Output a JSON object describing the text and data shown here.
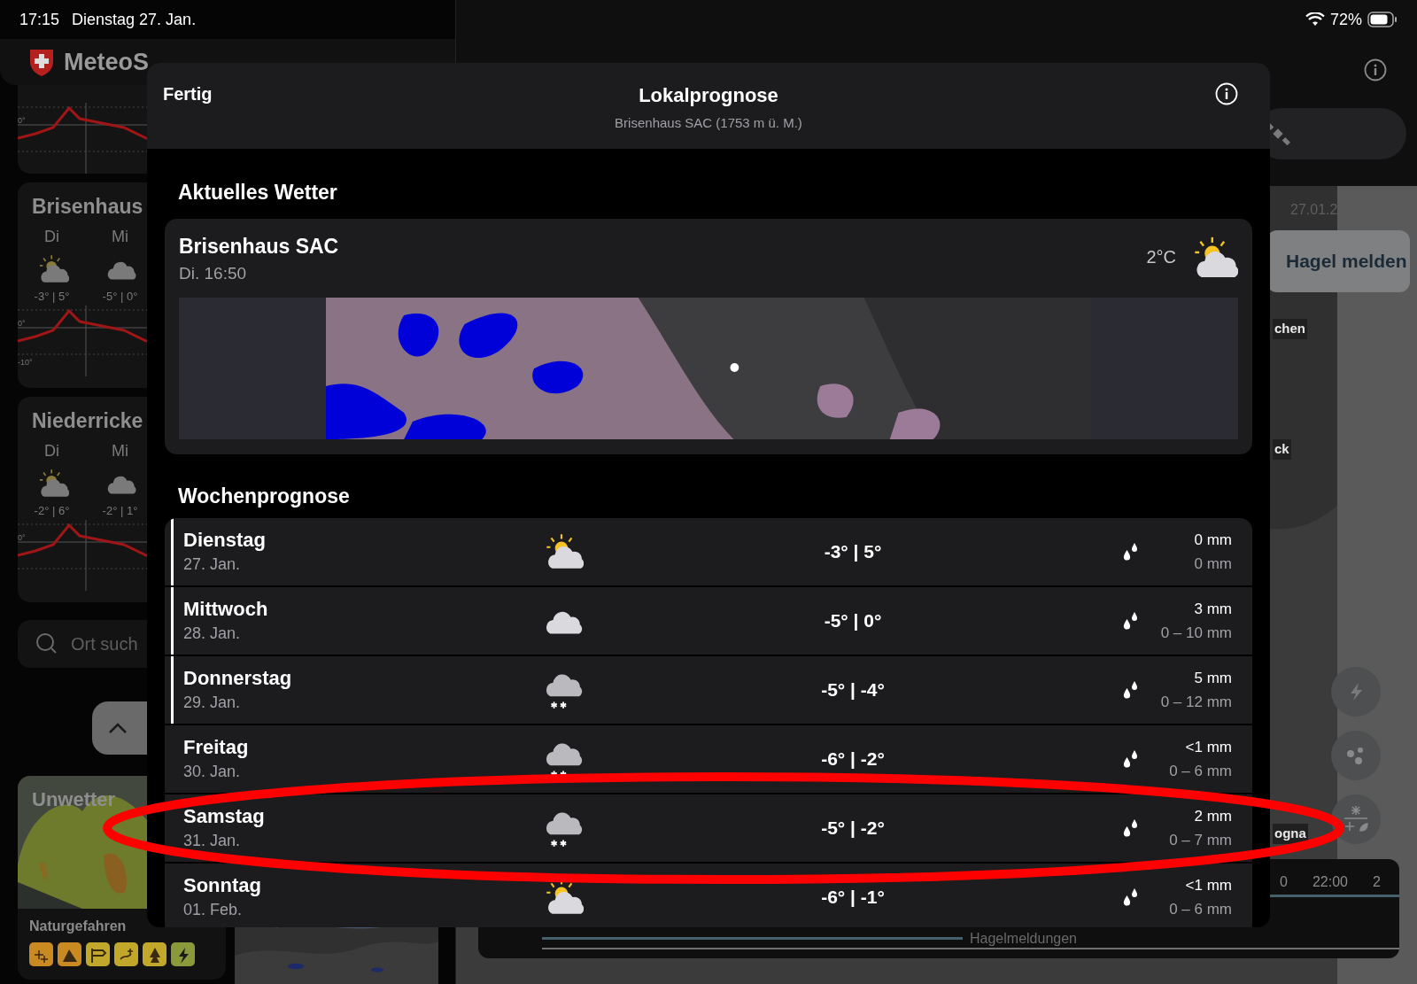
{
  "status_bar": {
    "time": "17:15",
    "date": "Dienstag 27. Jan.",
    "battery": "72%"
  },
  "sidebar": {
    "app_title": "MeteoS",
    "cards": [
      {
        "kind": "graph",
        "axis_labels": [
          "0°"
        ]
      },
      {
        "kind": "location",
        "title": "Brisenhaus",
        "days": [
          {
            "label": "Di",
            "kind": "sun_cloud",
            "temps": "-3° | 5°"
          },
          {
            "label": "Mi",
            "kind": "cloud",
            "temps": "-5° | 0°"
          }
        ],
        "axis_labels": [
          "0°",
          "-10°"
        ]
      },
      {
        "kind": "location",
        "title": "Niederricke",
        "days": [
          {
            "label": "Di",
            "kind": "sun_cloud",
            "temps": "-2° | 6°"
          },
          {
            "label": "Mi",
            "kind": "cloud",
            "temps": "-2° | 1°"
          }
        ],
        "axis_labels": [
          "0°"
        ]
      }
    ],
    "search": {
      "placeholder": "Ort such"
    },
    "warnings": {
      "title": "Unwetter",
      "hazards_label": "Naturgefahren",
      "hazards": [
        {
          "kind": "snow",
          "color": "#c98a22"
        },
        {
          "kind": "avalanche",
          "color": "#c98a22"
        },
        {
          "kind": "wind",
          "color": "#c2a82a"
        },
        {
          "kind": "ice",
          "color": "#c2a82a"
        },
        {
          "kind": "fire",
          "color": "#c2a82a"
        },
        {
          "kind": "thunder",
          "color": "#8a9a3a"
        }
      ]
    }
  },
  "map": {
    "date": "27.01.2",
    "report_button": "Hagel melden",
    "place_labels": [
      "chen",
      "ck",
      "ogna"
    ],
    "layer_buttons": [
      {
        "kind": "lightning"
      },
      {
        "kind": "dots"
      },
      {
        "kind": "snow"
      }
    ],
    "timeline": {
      "ticks": [
        "0",
        "22:00",
        "2"
      ],
      "layer": "Hagelmeldungen"
    }
  },
  "dialog": {
    "done": "Fertig",
    "title": "Lokalprognose",
    "subtitle": "Brisenhaus SAC (1753 m ü. M.)",
    "current": {
      "heading": "Aktuelles Wetter",
      "station": "Brisenhaus SAC",
      "time": "Di. 16:50",
      "temperature": "2°C",
      "kind": "sun_cloud"
    },
    "week": {
      "heading": "Wochenprognose",
      "days": [
        {
          "day": "Dienstag",
          "date": "27. Jan.",
          "kind": "sun_cloud",
          "temps": "-3° | 5°",
          "precip": "0 mm",
          "range": "0 mm",
          "marked": true
        },
        {
          "day": "Mittwoch",
          "date": "28. Jan.",
          "kind": "cloud",
          "temps": "-5° | 0°",
          "precip": "3 mm",
          "range": "0 – 10 mm",
          "marked": true
        },
        {
          "day": "Donnerstag",
          "date": "29. Jan.",
          "kind": "snow",
          "temps": "-5° | -4°",
          "precip": "5 mm",
          "range": "0 – 12 mm",
          "marked": true
        },
        {
          "day": "Freitag",
          "date": "30. Jan.",
          "kind": "snow",
          "temps": "-6° | -2°",
          "precip": "<1 mm",
          "range": "0 – 6 mm",
          "marked": false
        },
        {
          "day": "Samstag",
          "date": "31. Jan.",
          "kind": "snow",
          "temps": "-5° | -2°",
          "precip": "2 mm",
          "range": "0 – 7 mm",
          "marked": false
        },
        {
          "day": "Sonntag",
          "date": "01. Feb.",
          "kind": "sun_cloud",
          "temps": "-6° | -1°",
          "precip": "<1 mm",
          "range": "0 – 6 mm",
          "marked": false
        }
      ]
    }
  },
  "annotation": {
    "kind": "ellipse",
    "color": "#ff0000"
  }
}
